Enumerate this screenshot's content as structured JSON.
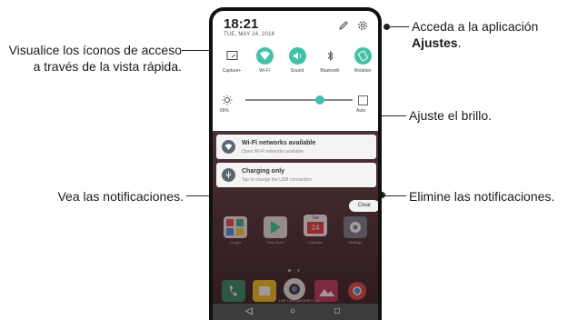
{
  "callouts": {
    "quick_access": "Visualice los íconos de acceso a través de la vista rápida.",
    "settings_prefix": "Acceda a la aplicación",
    "settings_bold": "Ajustes",
    "settings_suffix": ".",
    "brightness": "Ajuste el brillo.",
    "notifications": "Vea las notificaciones.",
    "clear": "Elimine las notificaciones."
  },
  "status": {
    "time": "18:21",
    "date": "TUE, MAY 24, 2016"
  },
  "quick_settings": [
    {
      "label": "Capture+",
      "icon": "capture-icon",
      "on": false
    },
    {
      "label": "Wi-Fi",
      "icon": "wifi-icon",
      "on": true
    },
    {
      "label": "Sound",
      "icon": "sound-icon",
      "on": true
    },
    {
      "label": "Bluetooth",
      "icon": "bluetooth-icon",
      "on": false
    },
    {
      "label": "Rotation",
      "icon": "rotation-icon",
      "on": true
    }
  ],
  "brightness": {
    "percent": "65%",
    "level": 0.65,
    "auto_label": "Auto"
  },
  "notifications": [
    {
      "title": "Wi-Fi networks available",
      "subtitle": "Open Wi-Fi networks available",
      "icon": "wifi-icon"
    },
    {
      "title": "Charging only",
      "subtitle": "Tap to change the USB connection",
      "icon": "usb-icon"
    }
  ],
  "clear_label": "Clear",
  "home_apps": [
    {
      "label": "Google"
    },
    {
      "label": "Play Store"
    },
    {
      "label": "Calendar",
      "day": "Tue",
      "date": "24"
    },
    {
      "label": "Settings"
    }
  ],
  "dock_text": "LGE LANG&HOME LT13",
  "colors": {
    "accent": "#43c1a7"
  }
}
